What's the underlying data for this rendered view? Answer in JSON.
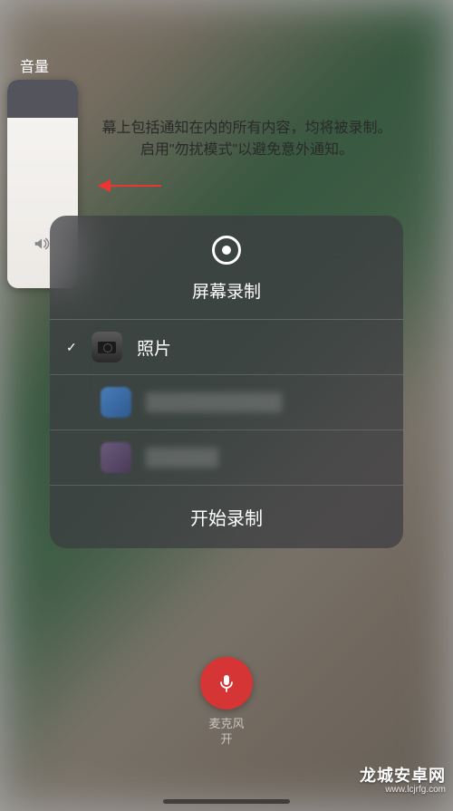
{
  "volume": {
    "label": "音量"
  },
  "notice": {
    "line1": "幕上包括通知在内的所有内容，均将被录制。",
    "line2": "启用\"勿扰模式\"以避免意外通知。"
  },
  "panel": {
    "title": "屏幕录制",
    "apps": [
      {
        "name": "照片",
        "selected": true,
        "icon": "camera"
      }
    ],
    "start_button": "开始录制"
  },
  "mic": {
    "label": "麦克风",
    "status": "开"
  },
  "watermark": {
    "main": "龙城安卓网",
    "sub": "www.lcjrfg.com"
  }
}
